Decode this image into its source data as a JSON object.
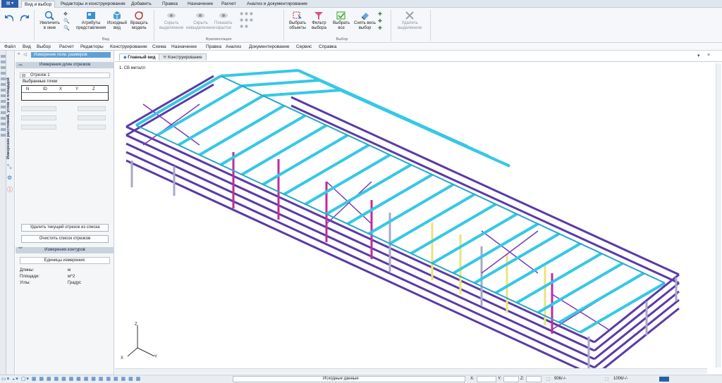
{
  "ribbon_tabs": [
    "Вид и выбор",
    "Редакторы и конструирование",
    "Добавить",
    "Правка",
    "Назначение",
    "Расчет",
    "Анализ и документирование"
  ],
  "ribbon": {
    "zoom_window": "Увеличить\nв окне",
    "view_attributes": "Атрибуты\nпредставления",
    "initial_view": "Исходный\nвид",
    "rotate_model": "Вращать\nмодель",
    "group_view": "Вид",
    "hide_selected": "Скрыть\nвыделенное",
    "hide_unselected": "Скрыть\nневыделенное",
    "show_hidden": "Показать\nскрытое",
    "group_fragment": "Фрагментация",
    "select_objects": "Выбрать\nобъекты",
    "select_filter": "Фильтр\nвыбора",
    "select_all": "Выбрать\nвсе",
    "clear_selection": "Снять весь\nвыбор",
    "delete_selected": "Удалить\nвыделенное",
    "group_select": "Выбор"
  },
  "menu": [
    "Файл",
    "Вид",
    "Выбор",
    "Расчет",
    "Редакторы",
    "Конструирование",
    "Схема",
    "Назначение",
    "Правка",
    "Анализ",
    "Документирование",
    "Сервис",
    "Справка"
  ],
  "side_vtabs": [
    "Измерение расстояний, углов и площадей"
  ],
  "panel": {
    "header_title": "Измерение геом. размеров",
    "section_lengths": "Измерения длин отрезков",
    "segment": "Отрезок 1",
    "selected_points": "Выбранные точки",
    "columns": [
      "N",
      "ID",
      "X",
      "Y",
      "Z"
    ],
    "btn_delete": "Удалить текущий отрезок из списка",
    "btn_clear": "Очистить список отрезков",
    "section_contours": "Измерения контуров",
    "units_title": "Единицы измерения:",
    "units": [
      {
        "label": "Длины:",
        "value": "м"
      },
      {
        "label": "Площади:",
        "value": "м^2"
      },
      {
        "label": "Углы:",
        "value": "Градус"
      }
    ]
  },
  "viewport": {
    "tabs": [
      "Главный вид",
      "Конструирование"
    ],
    "model_label": "1. СВ металл",
    "axes": [
      "X",
      "Y",
      "Z"
    ]
  },
  "status": {
    "source_data": "Исходные данные",
    "x_label": "X:",
    "y_label": "Y:",
    "z_label": "Z:",
    "nodes": "906/-/-",
    "elements": "1006/-/-"
  },
  "colors": {
    "beam_cyan": "#35c8e6",
    "frame_purple": "#5a3aa8",
    "column_magenta": "#c02c9a",
    "column_yellow": "#e9e57a",
    "column_gray": "#a8a8c8"
  }
}
